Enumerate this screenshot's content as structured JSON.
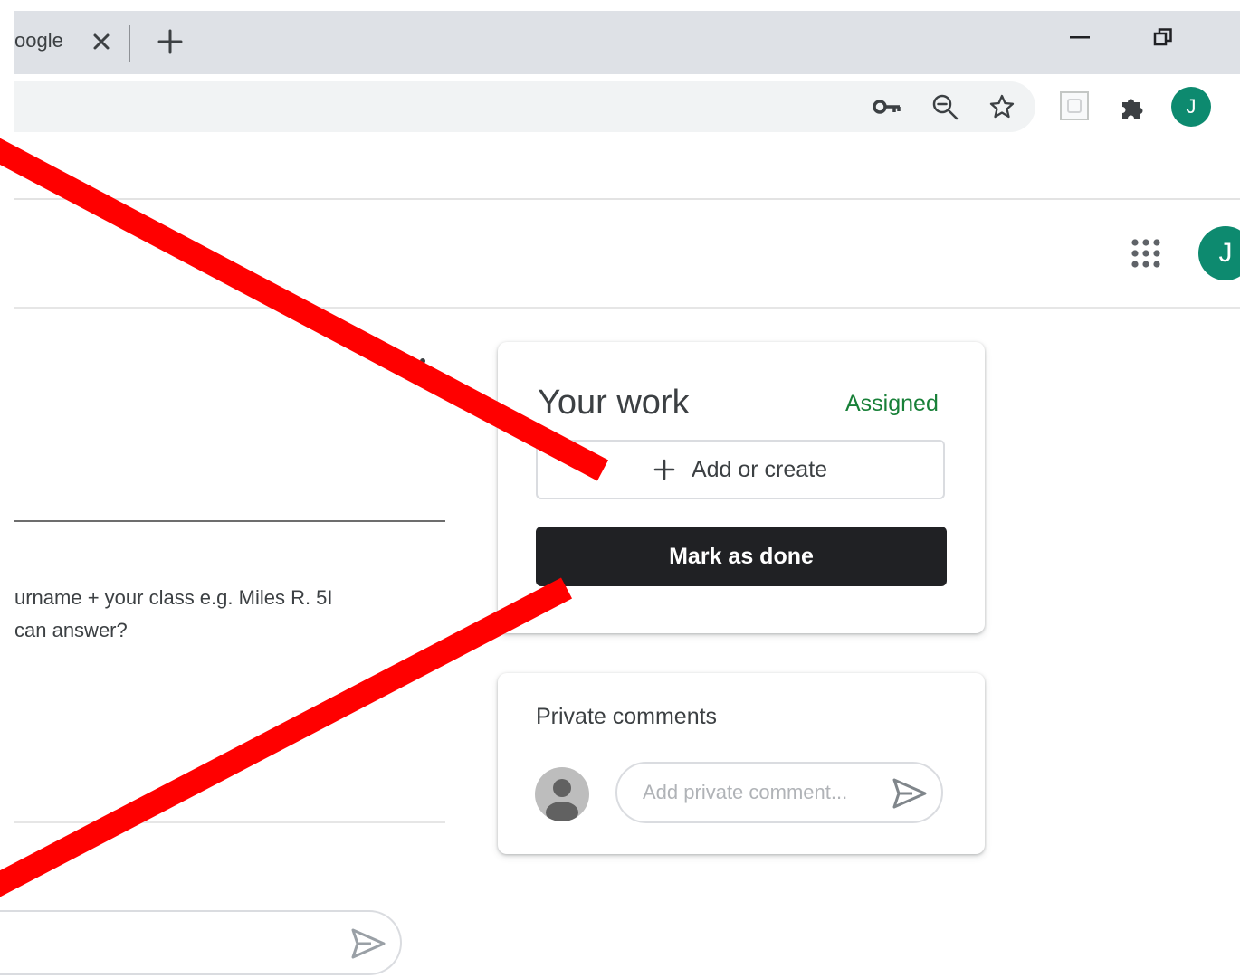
{
  "browser": {
    "tab_title": "oogle",
    "profile_initial": "J"
  },
  "app": {
    "profile_initial": "J"
  },
  "instructions": {
    "line1": "urname + your class e.g. Miles R. 5I",
    "line2": "can answer?"
  },
  "your_work": {
    "title": "Your work",
    "status": "Assigned",
    "status_color": "#188038",
    "add_label": "Add or create",
    "done_label": "Mark as done"
  },
  "private_comments": {
    "title": "Private comments",
    "placeholder": "Add private comment..."
  },
  "colors": {
    "profile": "#0d8a6f",
    "annotation": "#ff0000",
    "done_button": "#202124"
  },
  "icons": {
    "tab_close": "close-icon",
    "new_tab": "plus-icon",
    "password": "key-icon",
    "zoom": "zoom-out-icon",
    "bookmark": "star-icon",
    "extension_badge": "extension-badge-icon",
    "extensions": "puzzle-icon",
    "apps": "apps-grid-icon",
    "send": "send-icon"
  }
}
